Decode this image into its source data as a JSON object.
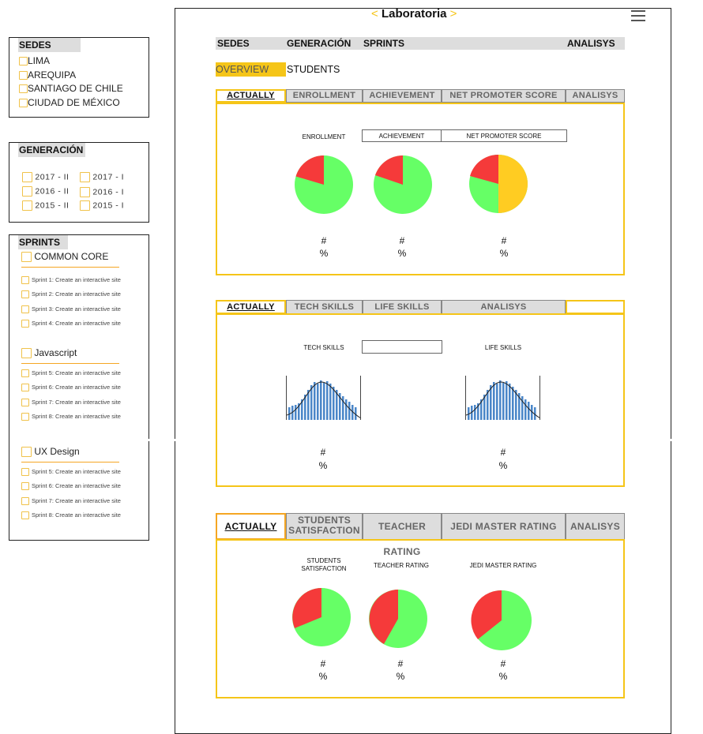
{
  "header": {
    "title": "Laboratoria",
    "left_arrow": "<",
    "right_arrow": ">",
    "menu_icon": "hamburger-icon"
  },
  "sidebar": {
    "sedes": {
      "title": "SEDES",
      "items": [
        "LIMA",
        "AREQUIPA",
        "SANTIAGO DE CHILE",
        "CIUDAD DE MÉXICO"
      ]
    },
    "generacion": {
      "title": "GENERACIÓN",
      "items": [
        "2017 - II",
        "2017 - I",
        "2016 - II",
        "2016 - I",
        "2015 - II",
        "2015 - I"
      ]
    },
    "sprints": {
      "title": "SPRINTS",
      "groups": [
        {
          "name": "COMMON CORE",
          "items": [
            "Sprint 1: Create an interactive site",
            "Sprint 2: Create an interactive site",
            "Sprint 3: Create an interactive site",
            "Sprint 4: Create an interactive site"
          ]
        },
        {
          "name": "Javascript",
          "items": [
            "Sprint 5: Create an interactive site",
            "Sprint 6: Create an interactive site",
            "Sprint 7: Create an interactive site",
            "Sprint 8: Create an interactive site"
          ]
        },
        {
          "name": "UX Design",
          "items": [
            "Sprint 5: Create an interactive site",
            "Sprint 6: Create an interactive site",
            "Sprint 7: Create an interactive site",
            "Sprint 8: Create an interactive site"
          ]
        }
      ]
    }
  },
  "nav": {
    "items": [
      "SEDES",
      "GENERACIÓN",
      "SPRINTS",
      "ANALISYS"
    ]
  },
  "view_tabs": {
    "overview": "OVERVIEW",
    "students": "STUDENTS"
  },
  "section1": {
    "tabs": [
      "ACTUALLY",
      "ENROLLMENT",
      "ACHIEVEMENT",
      "NET PROMOTER SCORE",
      "ANALISYS"
    ],
    "labels": [
      "ENROLLMENT",
      "ACHIEVEMENT",
      "NET PROMOTER SCORE"
    ],
    "stats": [
      [
        "#",
        "%"
      ],
      [
        "#",
        "%"
      ],
      [
        "#",
        "%"
      ]
    ]
  },
  "section2": {
    "tabs": [
      "ACTUALLY",
      "TECH SKILLS",
      "LIFE SKILLS",
      "ANALISYS"
    ],
    "labels": [
      "TECH SKILLS",
      "LIFE SKILLS"
    ],
    "stats": [
      [
        "#",
        "%"
      ],
      [
        "#",
        "%"
      ]
    ]
  },
  "section3": {
    "tabs": [
      "ACTUALLY",
      "STUDENTS SATISFACTION",
      "TEACHER RATING",
      "JEDI MASTER RATING",
      "ANALISYS"
    ],
    "tab1_lines": [
      "STUDENTS",
      "SATISFACTION"
    ],
    "labels": [
      "TEACHER RATING",
      "JEDI MASTER RATING"
    ],
    "label0_lines": [
      "STUDENTS",
      "SATISFACTION"
    ],
    "stats": [
      [
        "#",
        "%"
      ],
      [
        "#",
        "%"
      ],
      [
        "#",
        "%"
      ]
    ]
  },
  "colors": {
    "accent": "#f5c518",
    "red": "#f53a3a",
    "green": "#66ff66",
    "yellow": "#ffcc22",
    "blue": "#4a86c8"
  }
}
